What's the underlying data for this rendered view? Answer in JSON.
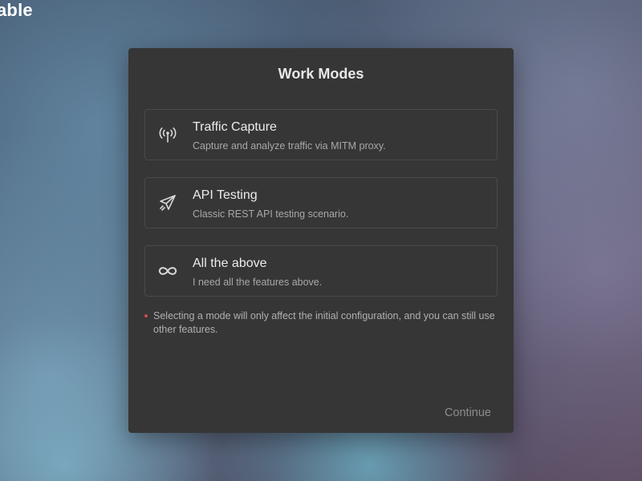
{
  "background": {
    "app_title_fragment": "able"
  },
  "dialog": {
    "title": "Work Modes",
    "modes": [
      {
        "icon": "antenna-icon",
        "title": "Traffic Capture",
        "description": "Capture and analyze traffic via MITM proxy."
      },
      {
        "icon": "paper-plane-icon",
        "title": "API Testing",
        "description": "Classic REST API testing scenario."
      },
      {
        "icon": "infinity-icon",
        "title": "All the above",
        "description": "I need all the features above."
      }
    ],
    "note": "Selecting a mode will only affect the initial configuration, and you can still use other features.",
    "continue_label": "Continue"
  },
  "colors": {
    "dialog_bg": "#363636",
    "card_border": "#4a4a4a",
    "note_bullet": "#d24a4a",
    "continue_disabled": "#8c8c8c"
  }
}
